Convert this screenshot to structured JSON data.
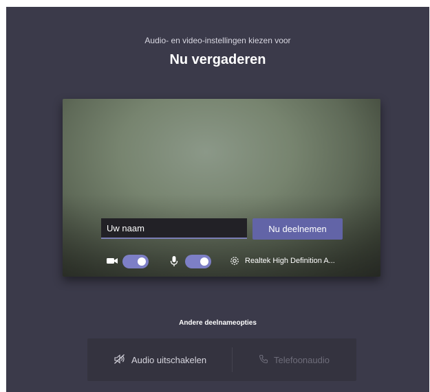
{
  "header": {
    "subtitle": "Audio- en video-instellingen kiezen voor",
    "title": "Nu vergaderen"
  },
  "preview": {
    "name_input": {
      "value": "Uw naam",
      "placeholder": ""
    },
    "join_label": "Nu deelnemen",
    "controls": {
      "camera_icon": "video-camera-icon",
      "camera_on": true,
      "mic_icon": "microphone-icon",
      "mic_on": true,
      "settings_icon": "gear-icon",
      "device_label": "Realtek High Definition A..."
    }
  },
  "other_options": {
    "heading": "Andere deelnameopties",
    "audio_off_icon": "speaker-off-icon",
    "audio_off_label": "Audio uitschakelen",
    "phone_icon": "phone-icon",
    "phone_label": "Telefoonaudio"
  },
  "colors": {
    "background": "#3b3a4a",
    "accent": "#6264a7",
    "toggle_on": "#7d7fc6"
  }
}
